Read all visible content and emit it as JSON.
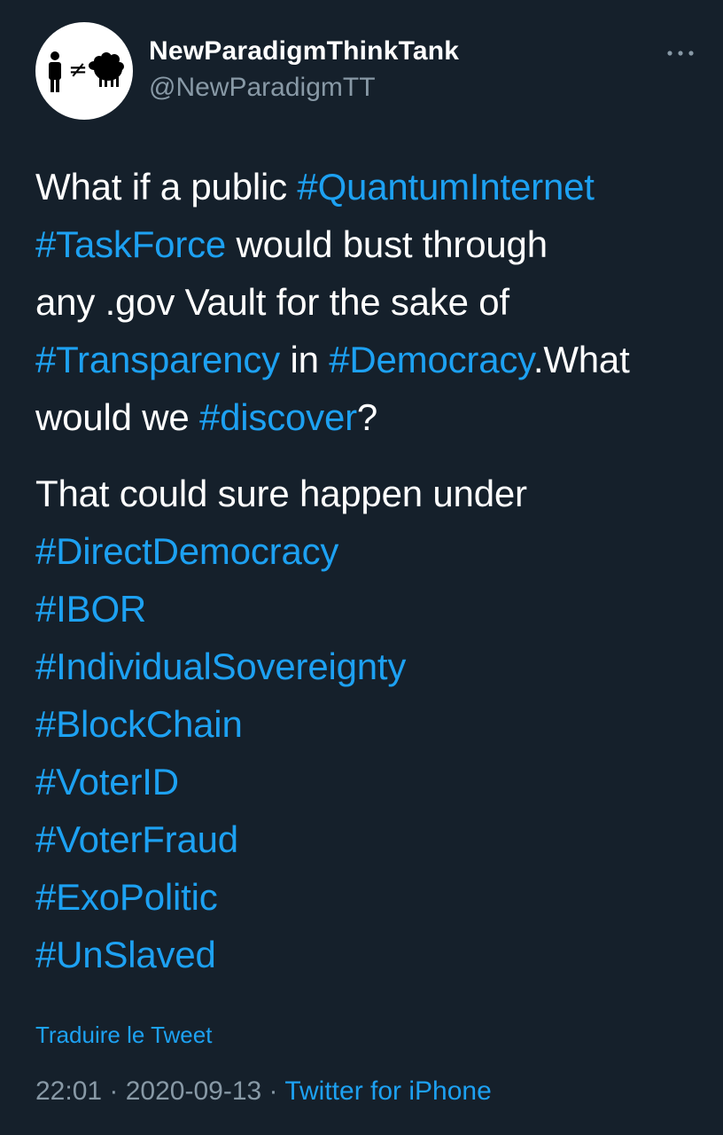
{
  "author": {
    "name": "NewParadigmThinkTank",
    "handle": "@NewParadigmTT",
    "avatar_icon": "person-not-equal-sheep-icon",
    "avatar_symbol": "≠"
  },
  "menu": {
    "more_icon": "more-horizontal-icon"
  },
  "tweet": {
    "p1": {
      "l1_t1": "What if a public ",
      "l1_h1": "#QuantumInternet",
      "l2_h1": "#TaskForce",
      "l2_t1": " would bust through",
      "l3_t1": "any .gov Vault for the sake of",
      "l4_h1": "#Transparency",
      "l4_t1": " in ",
      "l4_h2": "#Democracy",
      "l4_t2": ".What",
      "l5_t1": "would we ",
      "l5_h1": "#discover",
      "l5_t2": "?"
    },
    "p2": {
      "intro": "That could sure happen under",
      "hashtags": [
        "#DirectDemocracy",
        "#IBOR",
        "#IndividualSovereignty",
        "#BlockChain",
        "#VoterID",
        "#VoterFraud",
        "#ExoPolitic",
        "#UnSlaved"
      ]
    }
  },
  "translate_label": "Traduire le Tweet",
  "meta": {
    "time": "22:01",
    "separator": " · ",
    "date": "2020-09-13",
    "source": "Twitter for iPhone"
  },
  "colors": {
    "background": "#15202b",
    "text": "#ffffff",
    "link": "#1da1f2",
    "muted": "#8899a6"
  }
}
